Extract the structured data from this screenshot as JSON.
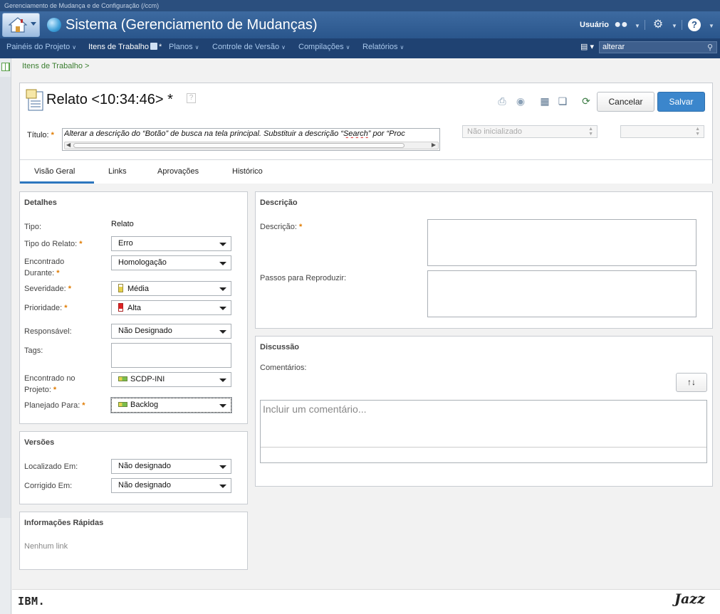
{
  "window": {
    "title": "Gerenciamento de Mudança e de Configuração (/ccm)"
  },
  "banner": {
    "project_title": "Sistema (Gerenciamento de Mudanças)",
    "user_label": "Usuário"
  },
  "nav": {
    "items": [
      {
        "label": "Painéis do Projeto"
      },
      {
        "label": "Itens de Trabalho"
      },
      {
        "label": "Planos"
      },
      {
        "label": "Controle de Versão"
      },
      {
        "label": "Compilações"
      },
      {
        "label": "Relatórios"
      }
    ],
    "search_value": "alterar"
  },
  "breadcrumb": "Itens de Trabalho >",
  "workitem": {
    "title": "Relato <10:34:46> *",
    "help_glyph": "?",
    "cancel_label": "Cancelar",
    "save_label": "Salvar",
    "title_label": "Título:",
    "title_value_pre": "Alterar a descrição do “Botão” de busca na tela principal. Substituir a descrição “",
    "title_value_word": "Search",
    "title_value_post": "” por “Proc",
    "state": "Não inicializado",
    "resolution": ""
  },
  "tabs": [
    {
      "label": "Visão Geral"
    },
    {
      "label": "Links"
    },
    {
      "label": "Aprovações"
    },
    {
      "label": "Histórico"
    }
  ],
  "details": {
    "heading": "Detalhes",
    "type_label": "Tipo:",
    "type_value": "Relato",
    "report_type_label": "Tipo do Relato:",
    "report_type_value": "Erro",
    "found_during_label": "Encontrado Durante:",
    "found_during_value": "Homologação",
    "severity_label": "Severidade:",
    "severity_value": "Média",
    "priority_label": "Prioridade:",
    "priority_value": "Alta",
    "owner_label": "Responsável:",
    "owner_value": "Não Designado",
    "tags_label": "Tags:",
    "found_in_label": "Encontrado no Projeto:",
    "found_in_value": "SCDP-INI",
    "planned_for_label": "Planejado Para:",
    "planned_for_value": "Backlog"
  },
  "versions": {
    "heading": "Versões",
    "found_in_label": "Localizado Em:",
    "found_in_value": "Não designado",
    "fixed_in_label": "Corrigido Em:",
    "fixed_in_value": "Não designado"
  },
  "quick_info": {
    "heading": "Informações Rápidas",
    "empty_text": "Nenhum link"
  },
  "description": {
    "heading": "Descrição",
    "description_label": "Descrição:",
    "steps_label": "Passos para Reproduzir:"
  },
  "discussion": {
    "heading": "Discussão",
    "comments_label": "Comentários:",
    "sort_glyph": "↑↓",
    "comment_placeholder": "Incluir um comentário..."
  },
  "footer": {
    "ibm": "IBM.",
    "jazz": "Jazz"
  },
  "icons": {
    "home": "home-icon",
    "globe": "globe-icon",
    "users": "users-icon",
    "gear": "gear-icon",
    "help": "help-icon",
    "search": "search-icon"
  },
  "colors": {
    "accent": "#3b86cc",
    "banner": "#2a568c",
    "required": "#e07b00",
    "link": "#3a7d2f"
  }
}
